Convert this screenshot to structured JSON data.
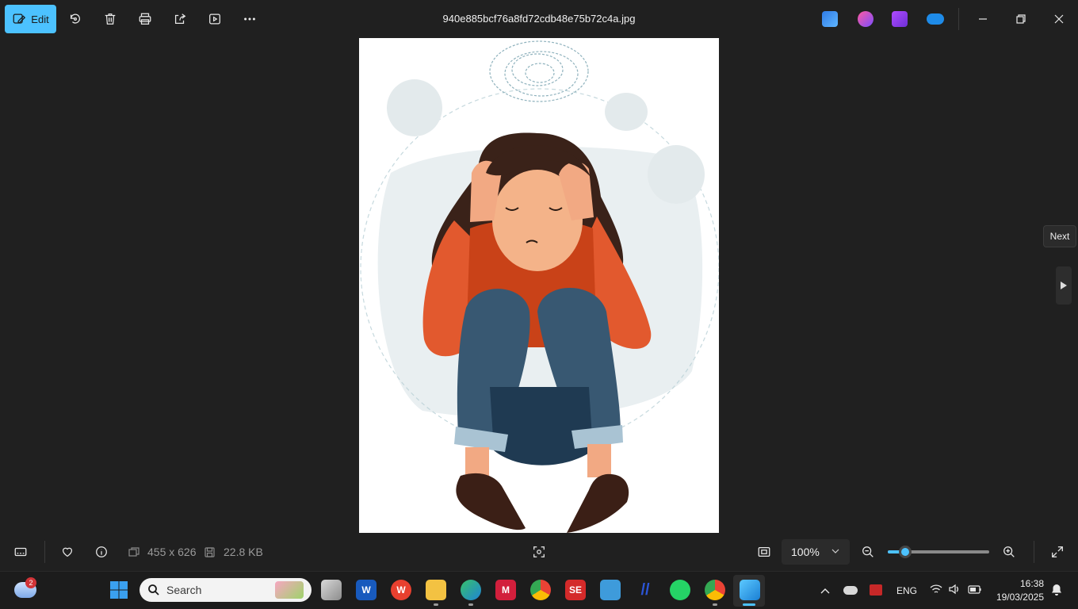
{
  "toolbar": {
    "edit_label": "Edit",
    "file_name": "940e885bcf76a8fd72cdb48e75b72c4a.jpg"
  },
  "navigation": {
    "next_tooltip": "Next"
  },
  "info_bar": {
    "dimensions": "455 x 626",
    "file_size": "22.8 KB",
    "zoom_value": "100%",
    "zoom_fraction": 0.1
  },
  "taskbar": {
    "search_placeholder": "Search",
    "weather_badge": "2",
    "language": "ENG",
    "time": "16:38",
    "date": "19/03/2025"
  },
  "colors": {
    "accent": "#4cc2ff",
    "background": "#202020"
  }
}
